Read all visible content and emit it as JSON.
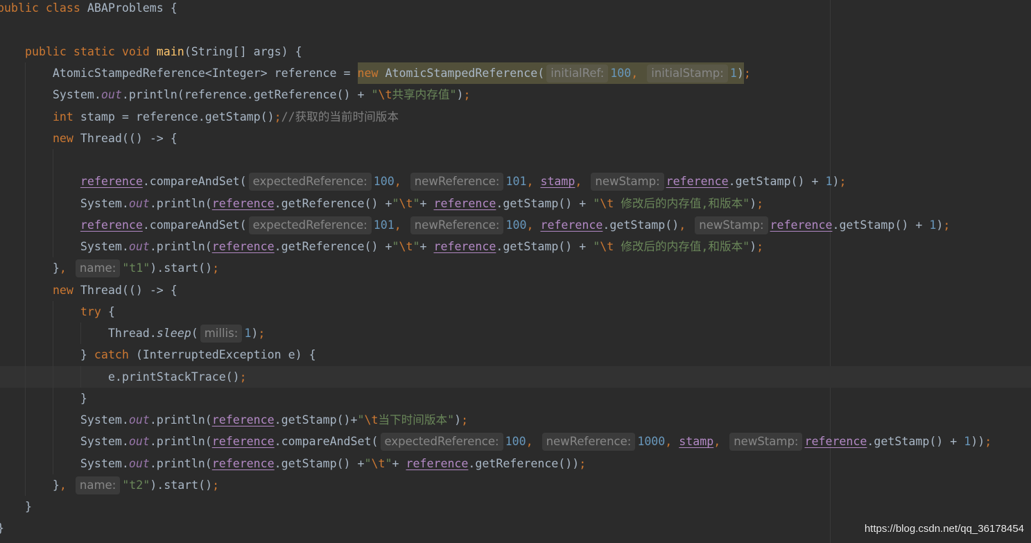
{
  "editor": {
    "colors": {
      "background": "#2b2b2b",
      "text": "#a9b7c6",
      "keyword": "#cc7832",
      "method": "#ffc66d",
      "string": "#6a8759",
      "escape": "#cc7832",
      "number": "#6897bb",
      "comment": "#808080",
      "punct": "#cc7832",
      "field": "#9876aa",
      "captured": "#b389c5",
      "hint_text": "#878787",
      "hint_background": "#3b3b3b",
      "hint_background_on_warning": "#5a5847",
      "warning_background": "#52503a",
      "current_line": "#323232",
      "margin_line": "#3a3a3a",
      "indent_guide": "#393939",
      "watermark": "#f0f0f0"
    },
    "lines": [
      {
        "tokens": [
          {
            "keyword": "public class"
          },
          {
            "text": " ABAProblems {"
          }
        ]
      },
      {
        "tokens": []
      },
      {
        "tokens": [
          {
            "text": "    "
          },
          {
            "keyword": "public static void"
          },
          {
            "text": " "
          },
          {
            "method": "main"
          },
          {
            "text": "(String[] args) {"
          }
        ]
      },
      {
        "tokens": [
          {
            "text": "        AtomicStampedReference<Integer> reference = "
          },
          {
            "warning_highlight": [
              {
                "keyword": "new"
              },
              {
                "text": " AtomicStampedReference("
              },
              {
                "hint": "initialRef:"
              },
              {
                "number": "100"
              },
              {
                "punct": ", "
              },
              {
                "hint": "initialStamp:"
              },
              {
                "number": "1"
              },
              {
                "text": ")"
              }
            ]
          },
          {
            "punct": ";"
          }
        ]
      },
      {
        "tokens": [
          {
            "text": "        System."
          },
          {
            "field": "out"
          },
          {
            "text": ".println(reference.getReference() + "
          },
          {
            "string": "\""
          },
          {
            "escape": "\\t"
          },
          {
            "string": "共享内存值\""
          },
          {
            "text": ")"
          },
          {
            "punct": ";"
          }
        ]
      },
      {
        "tokens": [
          {
            "text": "        "
          },
          {
            "keyword": "int"
          },
          {
            "text": " stamp = reference.getStamp()"
          },
          {
            "punct": ";"
          },
          {
            "comment": "//获取的当前时间版本"
          }
        ]
      },
      {
        "tokens": [
          {
            "text": "        "
          },
          {
            "keyword": "new"
          },
          {
            "text": " Thread(() -> {"
          }
        ]
      },
      {
        "tokens": []
      },
      {
        "tokens": [
          {
            "text": "            "
          },
          {
            "captured": "reference"
          },
          {
            "text": ".compareAndSet("
          },
          {
            "hint": "expectedReference:"
          },
          {
            "number": "100"
          },
          {
            "punct": ", "
          },
          {
            "hint": "newReference:"
          },
          {
            "number": "101"
          },
          {
            "punct": ", "
          },
          {
            "captured": "stamp"
          },
          {
            "punct": ", "
          },
          {
            "hint": "newStamp:"
          },
          {
            "captured": "reference"
          },
          {
            "text": ".getStamp() + "
          },
          {
            "number": "1"
          },
          {
            "text": ")"
          },
          {
            "punct": ";"
          }
        ]
      },
      {
        "tokens": [
          {
            "text": "            System."
          },
          {
            "field": "out"
          },
          {
            "text": ".println("
          },
          {
            "captured": "reference"
          },
          {
            "text": ".getReference() +"
          },
          {
            "string": "\""
          },
          {
            "escape": "\\t"
          },
          {
            "string": "\""
          },
          {
            "text": "+ "
          },
          {
            "captured": "reference"
          },
          {
            "text": ".getStamp() + "
          },
          {
            "string": "\""
          },
          {
            "escape": "\\t"
          },
          {
            "string": " 修改后的内存值,和版本\""
          },
          {
            "text": ")"
          },
          {
            "punct": ";"
          }
        ]
      },
      {
        "tokens": [
          {
            "text": "            "
          },
          {
            "captured": "reference"
          },
          {
            "text": ".compareAndSet("
          },
          {
            "hint": "expectedReference:"
          },
          {
            "number": "101"
          },
          {
            "punct": ", "
          },
          {
            "hint": "newReference:"
          },
          {
            "number": "100"
          },
          {
            "punct": ", "
          },
          {
            "captured": "reference"
          },
          {
            "text": ".getStamp()"
          },
          {
            "punct": ", "
          },
          {
            "hint": "newStamp:"
          },
          {
            "captured": "reference"
          },
          {
            "text": ".getStamp() + "
          },
          {
            "number": "1"
          },
          {
            "text": ")"
          },
          {
            "punct": ";"
          }
        ]
      },
      {
        "tokens": [
          {
            "text": "            System."
          },
          {
            "field": "out"
          },
          {
            "text": ".println("
          },
          {
            "captured": "reference"
          },
          {
            "text": ".getReference() +"
          },
          {
            "string": "\""
          },
          {
            "escape": "\\t"
          },
          {
            "string": "\""
          },
          {
            "text": "+ "
          },
          {
            "captured": "reference"
          },
          {
            "text": ".getStamp() + "
          },
          {
            "string": "\""
          },
          {
            "escape": "\\t"
          },
          {
            "string": " 修改后的内存值,和版本\""
          },
          {
            "text": ")"
          },
          {
            "punct": ";"
          }
        ]
      },
      {
        "tokens": [
          {
            "text": "        }"
          },
          {
            "punct": ", "
          },
          {
            "hint": "name:"
          },
          {
            "string": "\"t1\""
          },
          {
            "text": ").start()"
          },
          {
            "punct": ";"
          }
        ]
      },
      {
        "tokens": [
          {
            "text": "        "
          },
          {
            "keyword": "new"
          },
          {
            "text": " Thread(() -> {"
          }
        ]
      },
      {
        "tokens": [
          {
            "text": "            "
          },
          {
            "keyword": "try"
          },
          {
            "text": " {"
          }
        ]
      },
      {
        "tokens": [
          {
            "text": "                Thread."
          },
          {
            "static_call": "sleep"
          },
          {
            "text": "("
          },
          {
            "hint": "millis:"
          },
          {
            "number": "1"
          },
          {
            "text": ")"
          },
          {
            "punct": ";"
          }
        ]
      },
      {
        "tokens": [
          {
            "text": "            } "
          },
          {
            "keyword": "catch"
          },
          {
            "text": " (InterruptedException e) {"
          }
        ]
      },
      {
        "current": true,
        "tokens": [
          {
            "text": "                e.printStackTrace()"
          },
          {
            "punct": ";"
          }
        ]
      },
      {
        "tokens": [
          {
            "text": "            }"
          }
        ]
      },
      {
        "tokens": [
          {
            "text": "            System."
          },
          {
            "field": "out"
          },
          {
            "text": ".println("
          },
          {
            "captured": "reference"
          },
          {
            "text": ".getStamp()+"
          },
          {
            "string": "\""
          },
          {
            "escape": "\\t"
          },
          {
            "string": "当下时间版本\""
          },
          {
            "text": ")"
          },
          {
            "punct": ";"
          }
        ]
      },
      {
        "tokens": [
          {
            "text": "            System."
          },
          {
            "field": "out"
          },
          {
            "text": ".println("
          },
          {
            "captured": "reference"
          },
          {
            "text": ".compareAndSet("
          },
          {
            "hint": "expectedReference:"
          },
          {
            "number": "100"
          },
          {
            "punct": ", "
          },
          {
            "hint": "newReference:"
          },
          {
            "number": "1000"
          },
          {
            "punct": ", "
          },
          {
            "captured": "stamp"
          },
          {
            "punct": ", "
          },
          {
            "hint": "newStamp:"
          },
          {
            "captured": "reference"
          },
          {
            "text": ".getStamp() + "
          },
          {
            "number": "1"
          },
          {
            "text": "))"
          },
          {
            "punct": ";"
          }
        ]
      },
      {
        "tokens": [
          {
            "text": "            System."
          },
          {
            "field": "out"
          },
          {
            "text": ".println("
          },
          {
            "captured": "reference"
          },
          {
            "text": ".getStamp() +"
          },
          {
            "string": "\""
          },
          {
            "escape": "\\t"
          },
          {
            "string": "\""
          },
          {
            "text": "+ "
          },
          {
            "captured": "reference"
          },
          {
            "text": ".getReference())"
          },
          {
            "punct": ";"
          }
        ]
      },
      {
        "tokens": [
          {
            "text": "        }"
          },
          {
            "punct": ", "
          },
          {
            "hint": "name:"
          },
          {
            "string": "\"t2\""
          },
          {
            "text": ").start()"
          },
          {
            "punct": ";"
          }
        ]
      },
      {
        "tokens": [
          {
            "text": "    }"
          }
        ]
      },
      {
        "tokens": [
          {
            "text": "}"
          }
        ]
      }
    ]
  },
  "watermark": {
    "text": "https://blog.csdn.net/qq_36178454"
  }
}
